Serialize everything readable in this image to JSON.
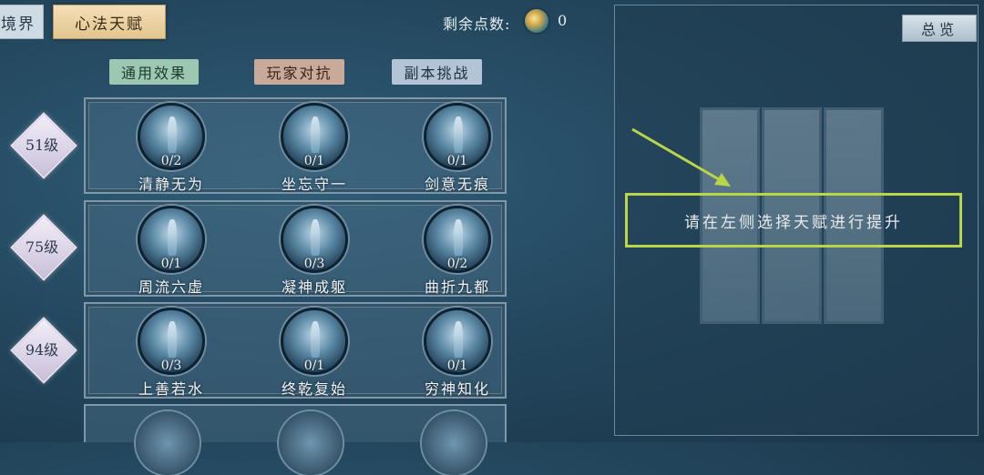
{
  "tabs": {
    "realm": "境界",
    "heart": "心法天赋"
  },
  "points": {
    "label": "剩余点数:",
    "value": "0"
  },
  "categories": {
    "general": "通用效果",
    "pvp": "玩家对抗",
    "dungeon": "副本挑战"
  },
  "rows": [
    {
      "level": "51级",
      "talents": [
        {
          "name": "清静无为",
          "progress": "0/2"
        },
        {
          "name": "坐忘守一",
          "progress": "0/1"
        },
        {
          "name": "剑意无痕",
          "progress": "0/1"
        }
      ]
    },
    {
      "level": "75级",
      "talents": [
        {
          "name": "周流六虚",
          "progress": "0/1"
        },
        {
          "name": "凝神成躯",
          "progress": "0/3"
        },
        {
          "name": "曲折九都",
          "progress": "0/2"
        }
      ]
    },
    {
      "level": "94级",
      "talents": [
        {
          "name": "上善若水",
          "progress": "0/3"
        },
        {
          "name": "终乾复始",
          "progress": "0/1"
        },
        {
          "name": "穷神知化",
          "progress": "0/1"
        }
      ]
    }
  ],
  "panel": {
    "overview": "总览",
    "hint": "请在左侧选择天赋进行提升"
  },
  "colors": {
    "highlight_box": "#b9d64a",
    "active_tab": "#e3c58f",
    "annotation_arrow": "#b9d64a"
  }
}
